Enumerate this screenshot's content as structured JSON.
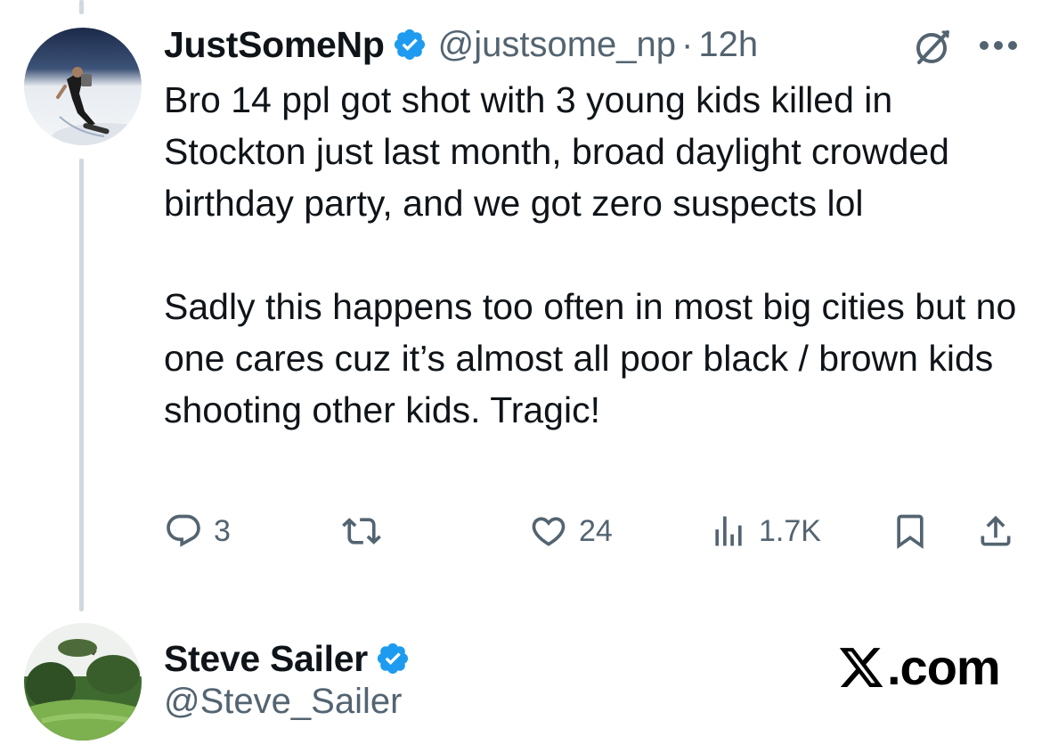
{
  "tweet": {
    "author_name": "JustSomeNp",
    "author_handle": "@justsome_np",
    "separator": "·",
    "time": "12h",
    "paragraphs": [
      "Bro 14 ppl got shot with 3 young kids killed in Stockton just last month, broad daylight crowded birthday party, and we got zero suspects lol",
      "Sadly this happens too often in most big cities but no one cares cuz it’s almost all poor black / brown kids shooting other kids. Tragic!"
    ],
    "replies": "3",
    "reposts": "",
    "likes": "24",
    "views": "1.7K"
  },
  "reply": {
    "author_name": "Steve Sailer",
    "author_handle": "@Steve_Sailer"
  },
  "brand": {
    "suffix": ".com"
  },
  "icons": {
    "verified": "verified-badge-icon",
    "grok": "grok-icon",
    "more": "more-icon",
    "reply": "reply-icon",
    "repost": "repost-icon",
    "like": "heart-icon",
    "views": "views-icon",
    "bookmark": "bookmark-icon",
    "share": "share-icon",
    "x_logo": "x-logo-icon"
  },
  "colors": {
    "verified": "#1d9bf0",
    "text": "#0f1419",
    "secondary": "#536471",
    "thread_line": "#cfd9de"
  }
}
